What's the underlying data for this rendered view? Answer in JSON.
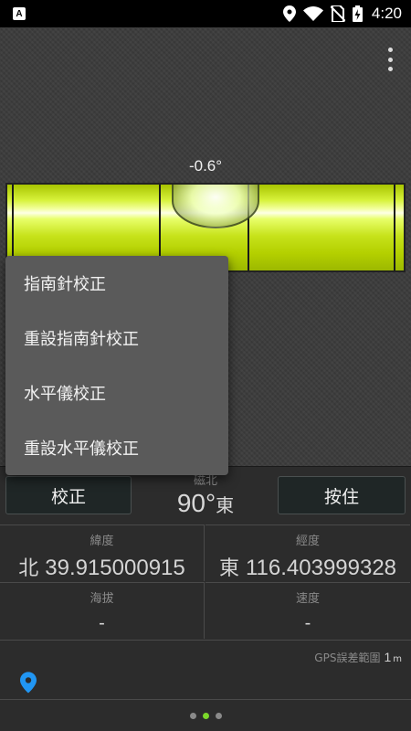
{
  "status_bar": {
    "app_badge": "A",
    "time": "4:20",
    "icons": [
      "location-icon",
      "wifi-icon",
      "no-sim-icon",
      "battery-charging-icon"
    ]
  },
  "level": {
    "angle": "-0.6°"
  },
  "popup_menu": {
    "items": [
      "指南針校正",
      "重設指南針校正",
      "水平儀校正",
      "重設水平儀校正"
    ]
  },
  "compass": {
    "calibrate_button": "校正",
    "hold_button": "按住",
    "label": "磁北",
    "degrees": "90°",
    "direction": "東"
  },
  "info": {
    "latitude": {
      "label": "緯度",
      "prefix": "北",
      "value": "39.915000915"
    },
    "longitude": {
      "label": "經度",
      "prefix": "東",
      "value": "116.403999328"
    },
    "altitude": {
      "label": "海拔",
      "value": "-"
    },
    "speed": {
      "label": "速度",
      "value": "-"
    }
  },
  "gps": {
    "label": "GPS誤差範圍",
    "value": "1",
    "unit": "m"
  },
  "pager": {
    "count": 3,
    "active": 1,
    "active_color": "#7bd82a"
  },
  "colors": {
    "tube": "#d7f23a",
    "accent_location": "#2196f3"
  }
}
